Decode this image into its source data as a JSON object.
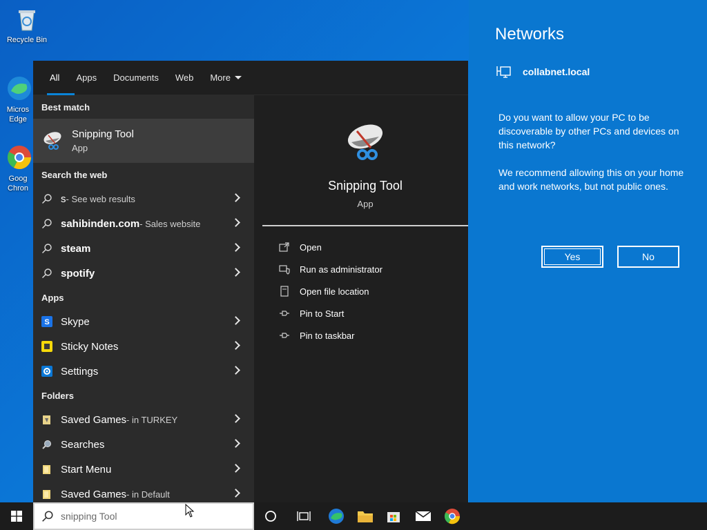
{
  "desktop": {
    "icons": [
      {
        "label": "Recycle Bin"
      },
      {
        "label": "Micros Edge"
      },
      {
        "label": "Goog Chron"
      }
    ]
  },
  "search": {
    "tabs": [
      "All",
      "Apps",
      "Documents",
      "Web",
      "More"
    ],
    "best_match_header": "Best match",
    "best_match": {
      "name": "Snipping Tool",
      "type": "App"
    },
    "web_header": "Search the web",
    "web_results": [
      {
        "text": "s",
        "suffix": " - See web results"
      },
      {
        "text": "sahibinden.com",
        "suffix": " - Sales website"
      },
      {
        "text": "steam",
        "suffix": ""
      },
      {
        "text": "spotify",
        "suffix": ""
      }
    ],
    "apps_header": "Apps",
    "apps": [
      {
        "text": "Skype"
      },
      {
        "text": "Sticky Notes"
      },
      {
        "text": "Settings"
      }
    ],
    "folders_header": "Folders",
    "folders": [
      {
        "text": "Saved Games",
        "suffix": " - in TURKEY"
      },
      {
        "text": "Searches",
        "suffix": ""
      },
      {
        "text": "Start Menu",
        "suffix": ""
      },
      {
        "text": "Saved Games",
        "suffix": " - in Default"
      }
    ],
    "preview": {
      "name": "Snipping Tool",
      "type": "App",
      "actions": [
        "Open",
        "Run as administrator",
        "Open file location",
        "Pin to Start",
        "Pin to taskbar"
      ]
    },
    "query": "snipping Tool"
  },
  "networks": {
    "title": "Networks",
    "network_name": "collabnet.local",
    "question": "Do you want to allow your PC to be discoverable by other PCs and devices on this network?",
    "recommend": "We recommend allowing this on your home and work networks, but not public ones.",
    "yes_label": "Yes",
    "no_label": "No"
  },
  "colors": {
    "accent": "#0a77d0",
    "panel_dark": "#1f1f1f",
    "panel_mid": "#2b2b2b"
  }
}
